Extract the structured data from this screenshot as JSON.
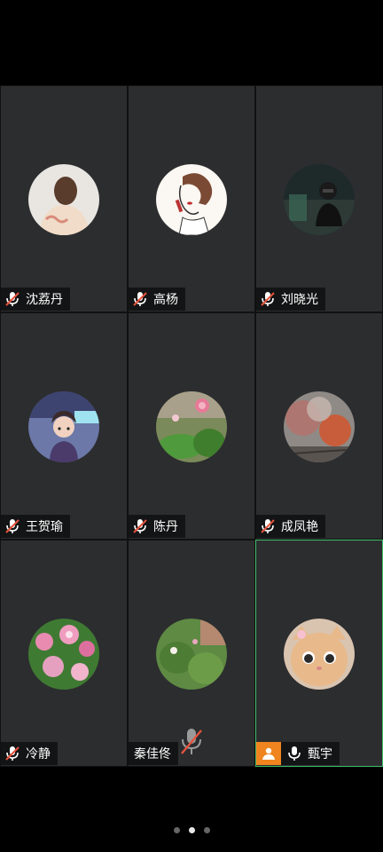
{
  "participants": [
    {
      "name": "沈荔丹",
      "mic": "muted",
      "avatar": "photo-woman-sweater-icon"
    },
    {
      "name": "高杨",
      "mic": "muted",
      "avatar": "sketch-woman-lipstick-icon"
    },
    {
      "name": "刘晓光",
      "mic": "muted",
      "avatar": "photo-dark-portrait-icon"
    },
    {
      "name": "王贺瑜",
      "mic": "muted",
      "avatar": "anime-girl-icon"
    },
    {
      "name": "陈丹",
      "mic": "muted",
      "avatar": "pink-flower-garden-icon"
    },
    {
      "name": "成凤艳",
      "mic": "muted",
      "avatar": "autumn-trees-icon"
    },
    {
      "name": "冷静",
      "mic": "muted",
      "avatar": "pink-flowers-icon"
    },
    {
      "name": "秦佳佟",
      "mic": "muted",
      "avatar": "green-plants-icon"
    },
    {
      "name": "甄宇",
      "mic": "on",
      "avatar": "cat-face-icon",
      "host": true,
      "speaking": true
    }
  ],
  "colors": {
    "tile_bg": "#2c2d2f",
    "active_border": "#3fbf6a",
    "host_badge": "#f0841e",
    "mute_red": "#e5533c"
  },
  "pager": {
    "pages": 3,
    "current": 2
  }
}
